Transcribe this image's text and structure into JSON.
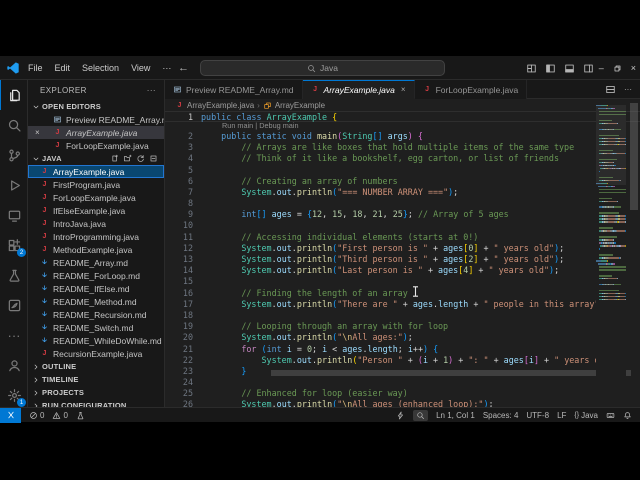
{
  "title_bar": {
    "menus": [
      "File",
      "Edit",
      "Selection",
      "View",
      "···"
    ],
    "search_value": "Java",
    "layout_icons": [
      "customize-layout-icon",
      "toggle-sidebar-icon",
      "toggle-panel-icon",
      "toggle-secondary-sidebar-icon"
    ],
    "window_controls": [
      "minimize-icon",
      "restore-icon",
      "close-icon"
    ]
  },
  "activity_bar": {
    "top": [
      {
        "icon": "files-icon",
        "active": true
      },
      {
        "icon": "search-icon"
      },
      {
        "icon": "source-control-icon"
      },
      {
        "icon": "run-debug-icon"
      },
      {
        "icon": "remote-explorer-icon"
      },
      {
        "icon": "extensions-icon",
        "badge": "2"
      },
      {
        "icon": "testing-icon"
      },
      {
        "icon": "custom-extension-icon"
      },
      {
        "icon": "more-icon"
      }
    ],
    "bottom": [
      {
        "icon": "account-icon"
      },
      {
        "icon": "settings-gear-icon",
        "badge": "1"
      }
    ]
  },
  "sidebar": {
    "title": "EXPLORER",
    "open_editors_label": "OPEN EDITORS",
    "open_editors": [
      {
        "icon": "markdown-preview-icon",
        "name": "Preview README_Array.md"
      },
      {
        "icon": "java-file-icon",
        "name": "ArrayExample.java",
        "active": true,
        "italic": true,
        "close": true
      },
      {
        "icon": "java-file-icon",
        "name": "ForLoopExample.java"
      }
    ],
    "folder_label": "JAVA",
    "folder_actions": [
      "new-file-icon",
      "new-folder-icon",
      "refresh-icon",
      "collapse-all-icon"
    ],
    "files": [
      {
        "icon": "java-file-icon",
        "name": "ArrayExample.java",
        "selected": true
      },
      {
        "icon": "java-file-icon",
        "name": "FirstProgram.java"
      },
      {
        "icon": "java-file-icon",
        "name": "ForLoopExample.java"
      },
      {
        "icon": "java-file-icon",
        "name": "IfElseExample.java"
      },
      {
        "icon": "java-file-icon",
        "name": "IntroJava.java"
      },
      {
        "icon": "java-file-icon",
        "name": "IntroProgramming.java"
      },
      {
        "icon": "java-file-icon",
        "name": "MethodExample.java"
      },
      {
        "icon": "markdown-file-icon",
        "name": "README_Array.md"
      },
      {
        "icon": "markdown-file-icon",
        "name": "README_ForLoop.md"
      },
      {
        "icon": "markdown-file-icon",
        "name": "README_IfElse.md"
      },
      {
        "icon": "markdown-file-icon",
        "name": "README_Method.md"
      },
      {
        "icon": "markdown-file-icon",
        "name": "README_Recursion.md"
      },
      {
        "icon": "markdown-file-icon",
        "name": "README_Switch.md"
      },
      {
        "icon": "markdown-file-icon",
        "name": "README_WhileDoWhile.md"
      },
      {
        "icon": "java-file-icon",
        "name": "RecursionExample.java"
      }
    ],
    "sections": [
      "OUTLINE",
      "TIMELINE",
      "PROJECTS",
      "RUN CONFIGURATION"
    ]
  },
  "editor": {
    "tabs": [
      {
        "icon": "markdown-preview-icon",
        "label": "Preview README_Array.md"
      },
      {
        "icon": "java-file-icon",
        "label": "ArrayExample.java",
        "active": true,
        "italic": true,
        "close": true
      },
      {
        "icon": "java-file-icon",
        "label": "ForLoopExample.java"
      }
    ],
    "tab_actions": [
      "split-editor-icon",
      "more-icon"
    ],
    "breadcrumb": [
      {
        "icon": "java-file-icon",
        "label": "ArrayExample.java"
      },
      {
        "icon": "class-symbol-icon",
        "label": "ArrayExample"
      }
    ],
    "code_lens": {
      "labels": [
        "Run main",
        "Debug main"
      ],
      "separator": " | ",
      "after_line": 1
    },
    "lines": [
      {
        "n": 1,
        "t": [
          [
            "kw",
            "public "
          ],
          [
            "kw",
            "class "
          ],
          [
            "type",
            "ArrayExample "
          ],
          [
            "b1",
            "{"
          ]
        ]
      },
      {
        "n": 2,
        "t": [
          [
            "pun",
            "    "
          ],
          [
            "kw",
            "public "
          ],
          [
            "kw",
            "static "
          ],
          [
            "kw",
            "void "
          ],
          [
            "fn",
            "main"
          ],
          [
            "b2",
            "("
          ],
          [
            "type",
            "String"
          ],
          [
            "b3",
            "[]"
          ],
          [
            "pun",
            " "
          ],
          [
            "var",
            "args"
          ],
          [
            "b2",
            ")"
          ],
          [
            "pun",
            " "
          ],
          [
            "b2",
            "{"
          ]
        ]
      },
      {
        "n": 3,
        "t": [
          [
            "pun",
            "        "
          ],
          [
            "com",
            "// Arrays are like boxes that hold multiple items of the same type"
          ]
        ]
      },
      {
        "n": 4,
        "t": [
          [
            "pun",
            "        "
          ],
          [
            "com",
            "// Think of it like a bookshelf, egg carton, or list of friends"
          ]
        ]
      },
      {
        "n": 5,
        "t": []
      },
      {
        "n": 6,
        "t": [
          [
            "pun",
            "        "
          ],
          [
            "com",
            "// Creating an array of numbers"
          ]
        ]
      },
      {
        "n": 7,
        "t": [
          [
            "pun",
            "        "
          ],
          [
            "type",
            "System"
          ],
          [
            "pun",
            "."
          ],
          [
            "var",
            "out"
          ],
          [
            "pun",
            "."
          ],
          [
            "fn",
            "println"
          ],
          [
            "b3",
            "("
          ],
          [
            "str",
            "\"=== NUMBER ARRAY ===\""
          ],
          [
            "b3",
            ")"
          ],
          [
            "pun",
            ";"
          ]
        ]
      },
      {
        "n": 8,
        "t": []
      },
      {
        "n": 9,
        "t": [
          [
            "pun",
            "        "
          ],
          [
            "kw",
            "int"
          ],
          [
            "b3",
            "[]"
          ],
          [
            "pun",
            " "
          ],
          [
            "var",
            "ages"
          ],
          [
            "pun",
            " = "
          ],
          [
            "b3",
            "{"
          ],
          [
            "num",
            "12"
          ],
          [
            "pun",
            ", "
          ],
          [
            "num",
            "15"
          ],
          [
            "pun",
            ", "
          ],
          [
            "num",
            "18"
          ],
          [
            "pun",
            ", "
          ],
          [
            "num",
            "21"
          ],
          [
            "pun",
            ", "
          ],
          [
            "num",
            "25"
          ],
          [
            "b3",
            "}"
          ],
          [
            "pun",
            "; "
          ],
          [
            "com",
            "// Array of 5 ages"
          ]
        ]
      },
      {
        "n": 10,
        "t": []
      },
      {
        "n": 11,
        "t": [
          [
            "pun",
            "        "
          ],
          [
            "com",
            "// Accessing individual elements (starts at 0!)"
          ]
        ]
      },
      {
        "n": 12,
        "t": [
          [
            "pun",
            "        "
          ],
          [
            "type",
            "System"
          ],
          [
            "pun",
            "."
          ],
          [
            "var",
            "out"
          ],
          [
            "pun",
            "."
          ],
          [
            "fn",
            "println"
          ],
          [
            "b3",
            "("
          ],
          [
            "str",
            "\"First person is \""
          ],
          [
            "pun",
            " + "
          ],
          [
            "var",
            "ages"
          ],
          [
            "b1",
            "["
          ],
          [
            "num",
            "0"
          ],
          [
            "b1",
            "]"
          ],
          [
            "pun",
            " + "
          ],
          [
            "str",
            "\" years old\""
          ],
          [
            "b3",
            ")"
          ],
          [
            "pun",
            ";"
          ]
        ]
      },
      {
        "n": 13,
        "t": [
          [
            "pun",
            "        "
          ],
          [
            "type",
            "System"
          ],
          [
            "pun",
            "."
          ],
          [
            "var",
            "out"
          ],
          [
            "pun",
            "."
          ],
          [
            "fn",
            "println"
          ],
          [
            "b3",
            "("
          ],
          [
            "str",
            "\"Third person is \""
          ],
          [
            "pun",
            " + "
          ],
          [
            "var",
            "ages"
          ],
          [
            "b1",
            "["
          ],
          [
            "num",
            "2"
          ],
          [
            "b1",
            "]"
          ],
          [
            "pun",
            " + "
          ],
          [
            "str",
            "\" years old\""
          ],
          [
            "b3",
            ")"
          ],
          [
            "pun",
            ";"
          ]
        ]
      },
      {
        "n": 14,
        "t": [
          [
            "pun",
            "        "
          ],
          [
            "type",
            "System"
          ],
          [
            "pun",
            "."
          ],
          [
            "var",
            "out"
          ],
          [
            "pun",
            "."
          ],
          [
            "fn",
            "println"
          ],
          [
            "b3",
            "("
          ],
          [
            "str",
            "\"Last person is \""
          ],
          [
            "pun",
            " + "
          ],
          [
            "var",
            "ages"
          ],
          [
            "b1",
            "["
          ],
          [
            "num",
            "4"
          ],
          [
            "b1",
            "]"
          ],
          [
            "pun",
            " + "
          ],
          [
            "str",
            "\" years old\""
          ],
          [
            "b3",
            ")"
          ],
          [
            "pun",
            ";"
          ]
        ]
      },
      {
        "n": 15,
        "t": []
      },
      {
        "n": 16,
        "t": [
          [
            "pun",
            "        "
          ],
          [
            "com",
            "// Finding the length of an array"
          ]
        ]
      },
      {
        "n": 17,
        "t": [
          [
            "pun",
            "        "
          ],
          [
            "type",
            "System"
          ],
          [
            "pun",
            "."
          ],
          [
            "var",
            "out"
          ],
          [
            "pun",
            "."
          ],
          [
            "fn",
            "println"
          ],
          [
            "b3",
            "("
          ],
          [
            "str",
            "\"There are \""
          ],
          [
            "pun",
            " + "
          ],
          [
            "var",
            "ages"
          ],
          [
            "pun",
            "."
          ],
          [
            "var",
            "length"
          ],
          [
            "pun",
            " + "
          ],
          [
            "str",
            "\" people in this array\""
          ],
          [
            "b3",
            ")"
          ],
          [
            "pun",
            ";"
          ]
        ]
      },
      {
        "n": 18,
        "t": []
      },
      {
        "n": 19,
        "t": [
          [
            "pun",
            "        "
          ],
          [
            "com",
            "// Looping through an array with for loop"
          ]
        ]
      },
      {
        "n": 20,
        "t": [
          [
            "pun",
            "        "
          ],
          [
            "type",
            "System"
          ],
          [
            "pun",
            "."
          ],
          [
            "var",
            "out"
          ],
          [
            "pun",
            "."
          ],
          [
            "fn",
            "println"
          ],
          [
            "b3",
            "("
          ],
          [
            "str",
            "\""
          ],
          [
            "esc",
            "\\n"
          ],
          [
            "str",
            "All ages:\""
          ],
          [
            "b3",
            ")"
          ],
          [
            "pun",
            ";"
          ]
        ]
      },
      {
        "n": 21,
        "t": [
          [
            "pun",
            "        "
          ],
          [
            "ctrl",
            "for"
          ],
          [
            "pun",
            " "
          ],
          [
            "b3",
            "("
          ],
          [
            "kw",
            "int"
          ],
          [
            "pun",
            " "
          ],
          [
            "var",
            "i"
          ],
          [
            "pun",
            " = "
          ],
          [
            "num",
            "0"
          ],
          [
            "pun",
            "; "
          ],
          [
            "var",
            "i"
          ],
          [
            "pun",
            " < "
          ],
          [
            "var",
            "ages"
          ],
          [
            "pun",
            "."
          ],
          [
            "var",
            "length"
          ],
          [
            "pun",
            "; "
          ],
          [
            "var",
            "i"
          ],
          [
            "pun",
            "++"
          ],
          [
            "b3",
            ")"
          ],
          [
            "pun",
            " "
          ],
          [
            "b3",
            "{"
          ]
        ]
      },
      {
        "n": 22,
        "t": [
          [
            "pun",
            "            "
          ],
          [
            "type",
            "System"
          ],
          [
            "pun",
            "."
          ],
          [
            "var",
            "out"
          ],
          [
            "pun",
            "."
          ],
          [
            "fn",
            "println"
          ],
          [
            "b1",
            "("
          ],
          [
            "str",
            "\"Person \""
          ],
          [
            "pun",
            " + "
          ],
          [
            "b2",
            "("
          ],
          [
            "var",
            "i"
          ],
          [
            "pun",
            " + "
          ],
          [
            "num",
            "1"
          ],
          [
            "b2",
            ")"
          ],
          [
            "pun",
            " + "
          ],
          [
            "str",
            "\": \""
          ],
          [
            "pun",
            " + "
          ],
          [
            "var",
            "ages"
          ],
          [
            "b2",
            "["
          ],
          [
            "var",
            "i"
          ],
          [
            "b2",
            "]"
          ],
          [
            "pun",
            " + "
          ],
          [
            "str",
            "\" years old\""
          ],
          [
            "b1",
            ")"
          ],
          [
            "pun",
            ";"
          ]
        ]
      },
      {
        "n": 23,
        "t": [
          [
            "pun",
            "        "
          ],
          [
            "b3",
            "}"
          ]
        ]
      },
      {
        "n": 24,
        "t": []
      },
      {
        "n": 25,
        "t": [
          [
            "pun",
            "        "
          ],
          [
            "com",
            "// Enhanced for loop (easier way)"
          ]
        ]
      },
      {
        "n": 26,
        "t": [
          [
            "pun",
            "        "
          ],
          [
            "type",
            "System"
          ],
          [
            "pun",
            "."
          ],
          [
            "var",
            "out"
          ],
          [
            "pun",
            "."
          ],
          [
            "fn",
            "println"
          ],
          [
            "b3",
            "("
          ],
          [
            "str",
            "\""
          ],
          [
            "esc",
            "\\n"
          ],
          [
            "str",
            "All ages (enhanced loop):\""
          ],
          [
            "b3",
            ")"
          ],
          [
            "pun",
            ";"
          ]
        ]
      }
    ]
  },
  "status_bar": {
    "left": [
      {
        "icon": "remote-icon",
        "blue": true
      },
      {
        "icon": "errors-icon",
        "text": "0"
      },
      {
        "icon": "warnings-icon",
        "text": "0"
      },
      {
        "icon": "beaker-icon"
      }
    ],
    "right": [
      {
        "icon": "lightning-icon"
      },
      {
        "icon": "magnifier-icon",
        "boxed": true
      },
      {
        "text": "Ln 1, Col 1"
      },
      {
        "text": "Spaces: 4"
      },
      {
        "text": "UTF-8"
      },
      {
        "text": "LF"
      },
      {
        "icon": "braces-icon",
        "text": "Java"
      },
      {
        "icon": "keyboard-icon"
      },
      {
        "icon": "bell-icon"
      }
    ]
  },
  "colors": {
    "accent": "#0078d4",
    "java_icon": "#d23b42",
    "markdown_icon": "#42a5f5",
    "selection_bg": "#094771",
    "editor_bg": "#1f1f1f",
    "chrome_bg": "#181818"
  }
}
